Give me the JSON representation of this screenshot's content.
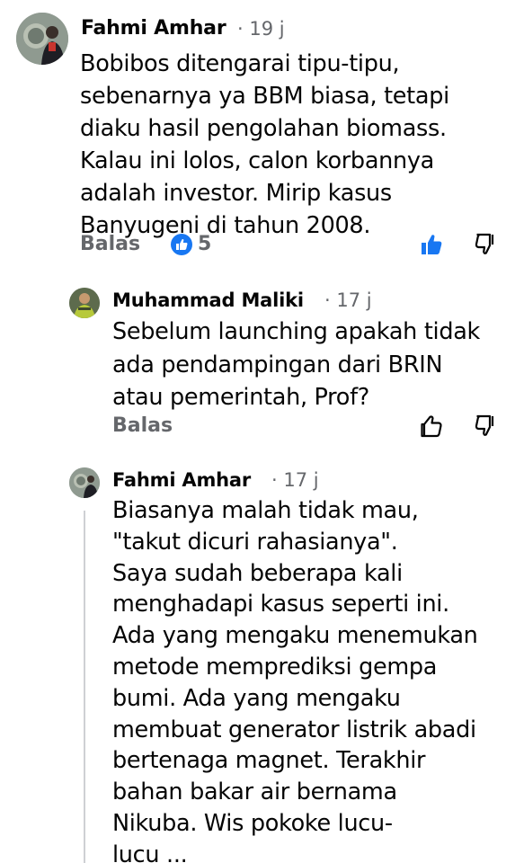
{
  "colors": {
    "text": "#050505",
    "secondary": "#65676b",
    "like_blue": "#1877f2",
    "thread_line": "#ced0d4"
  },
  "comments": [
    {
      "author": "Fahmi Amhar",
      "time": "· 19 j",
      "text": "Bobibos ditengarai tipu-tipu,\nsebenarnya ya BBM biasa, tetapi\ndiaku hasil pengolahan biomass.\nKalau ini lolos, calon korbannya\nadalah investor.  Mirip kasus\nBanyugeni di tahun 2008.",
      "reply_label": "Balas",
      "reaction_icon": "like-reaction-icon",
      "reaction_count": "5",
      "like_state": "liked"
    },
    {
      "author": "Muhammad Maliki",
      "time": "· 17 j",
      "text": "Sebelum launching apakah tidak\nada pendampingan dari BRIN\natau pemerintah, Prof?",
      "reply_label": "Balas",
      "like_state": "not-liked"
    },
    {
      "author": "Fahmi Amhar",
      "time": "· 17 j",
      "text": "Biasanya malah tidak mau,\n\"takut dicuri rahasianya\".\nSaya sudah beberapa kali\nmenghadapi kasus seperti ini.\nAda yang mengaku menemukan\nmetode memprediksi gempa\nbumi.  Ada yang mengaku\nmembuat generator listrik abadi\nbertenaga magnet.  Terakhir\nbahan bakar air bernama\nNikuba.  Wis pokoke lucu-\nlucu ..."
    }
  ]
}
